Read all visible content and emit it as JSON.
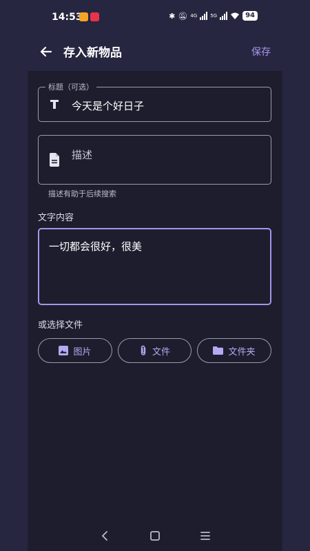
{
  "status_bar": {
    "time": "14:53",
    "battery": "94",
    "network_a": "4G",
    "network_b": "5G"
  },
  "app_bar": {
    "title": "存入新物品",
    "save_label": "保存"
  },
  "form": {
    "title_field": {
      "label": "标题（可选）",
      "value": "今天是个好日子",
      "icon": "text-fields-icon"
    },
    "description_field": {
      "placeholder": "描述",
      "helper": "描述有助于后续搜索",
      "icon": "document-icon"
    },
    "text_content": {
      "label": "文字内容",
      "value": "一切都会很好，很美"
    },
    "file_section": {
      "label": "或选择文件",
      "buttons": [
        {
          "label": "图片",
          "icon": "image-icon"
        },
        {
          "label": "文件",
          "icon": "paperclip-icon"
        },
        {
          "label": "文件夹",
          "icon": "folder-icon"
        }
      ]
    }
  },
  "colors": {
    "accent": "#a696ec",
    "background": "#262640",
    "surface": "#1e1d2e"
  }
}
